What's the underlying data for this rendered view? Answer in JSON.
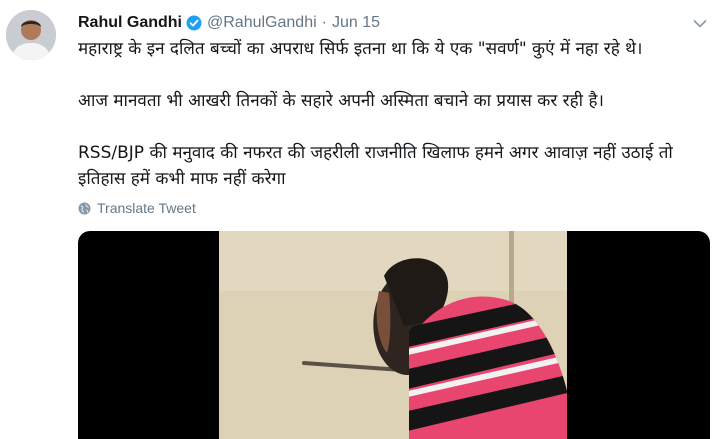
{
  "tweet": {
    "author_name": "Rahul Gandhi",
    "handle": "@RahulGandhi",
    "separator": "·",
    "date": "Jun 15",
    "paragraphs": [
      "महाराष्ट्र के इन दलित बच्चों का अपराध सिर्फ इतना था कि ये एक \"सवर्ण\" कुएं में नहा रहे थे।",
      "आज मानवता भी आखरी तिनकों के सहारे अपनी अस्मिता बचाने का प्रयास कर रही है।",
      "RSS/BJP की मनुवाद की नफरत की जहरीली राजनीति खिलाफ हमने अगर आवाज़ नहीं उठाई तो इतिहास हमें कभी माफ नहीं करेगा"
    ],
    "translate_label": "Translate Tweet"
  },
  "icons": {
    "verified": "verified-badge-icon",
    "caret": "chevron-down-icon",
    "translate": "globe-icon"
  },
  "colors": {
    "verified_blue": "#1da1f2",
    "secondary_text": "#657786",
    "primary_text": "#14171a",
    "shirt_pink": "#e8456f",
    "shirt_black": "#151515"
  }
}
